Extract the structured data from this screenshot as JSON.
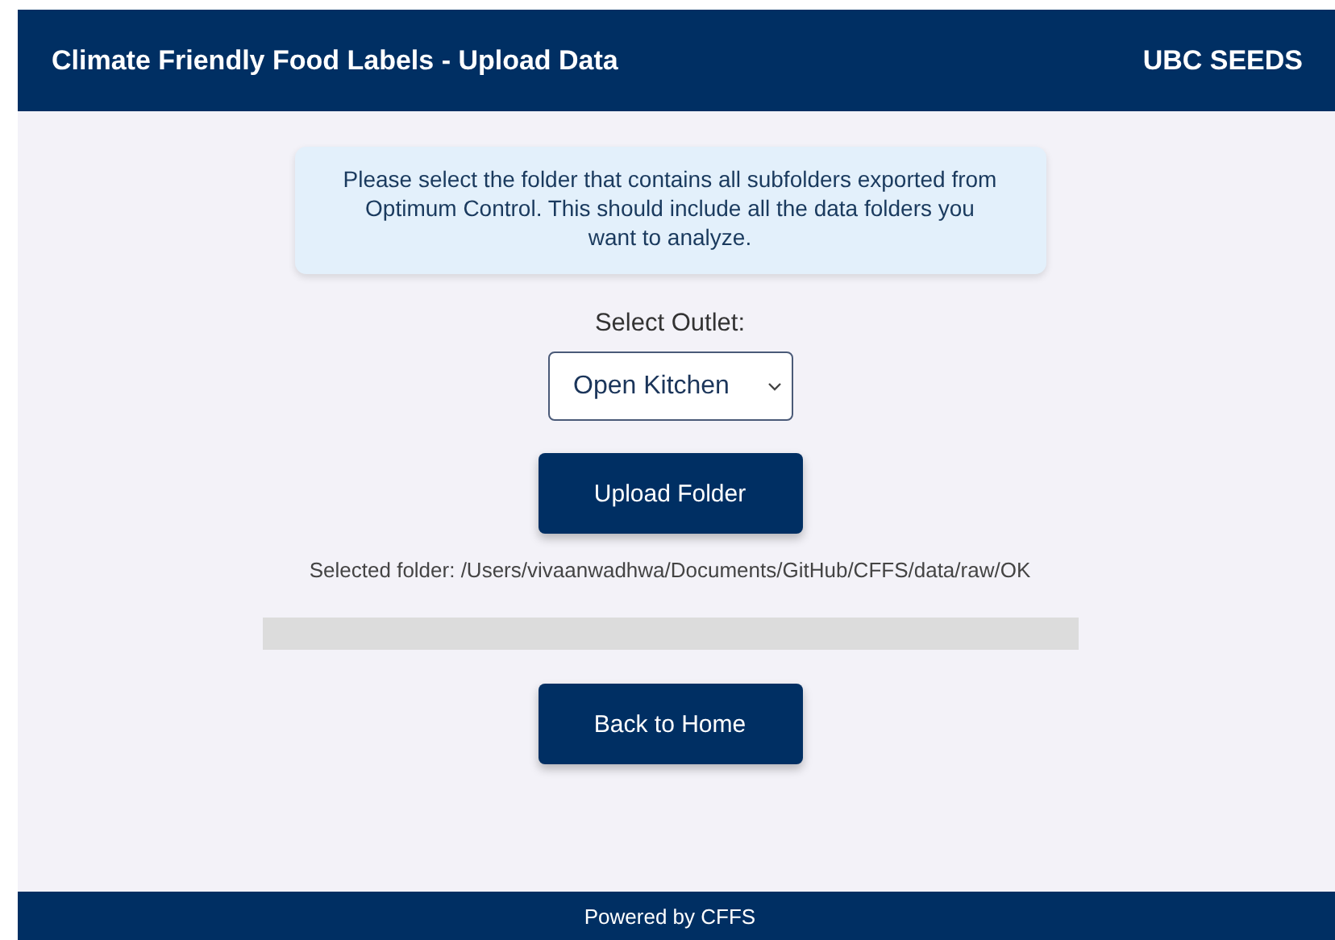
{
  "header": {
    "title": "Climate Friendly Food Labels - Upload Data",
    "brand": "UBC SEEDS"
  },
  "info_box": {
    "text": "Please select the folder that contains all subfolders exported from Optimum Control. This should include all the data folders you want to analyze."
  },
  "outlet": {
    "label": "Select Outlet:",
    "value": "Open Kitchen"
  },
  "upload_button": "Upload Folder",
  "selected_folder": "Selected folder: /Users/vivaanwadhwa/Documents/GitHub/CFFS/data/raw/OK",
  "progress": {
    "level": 0
  },
  "back_button": "Back to Home",
  "footer": "Powered by CFFS"
}
